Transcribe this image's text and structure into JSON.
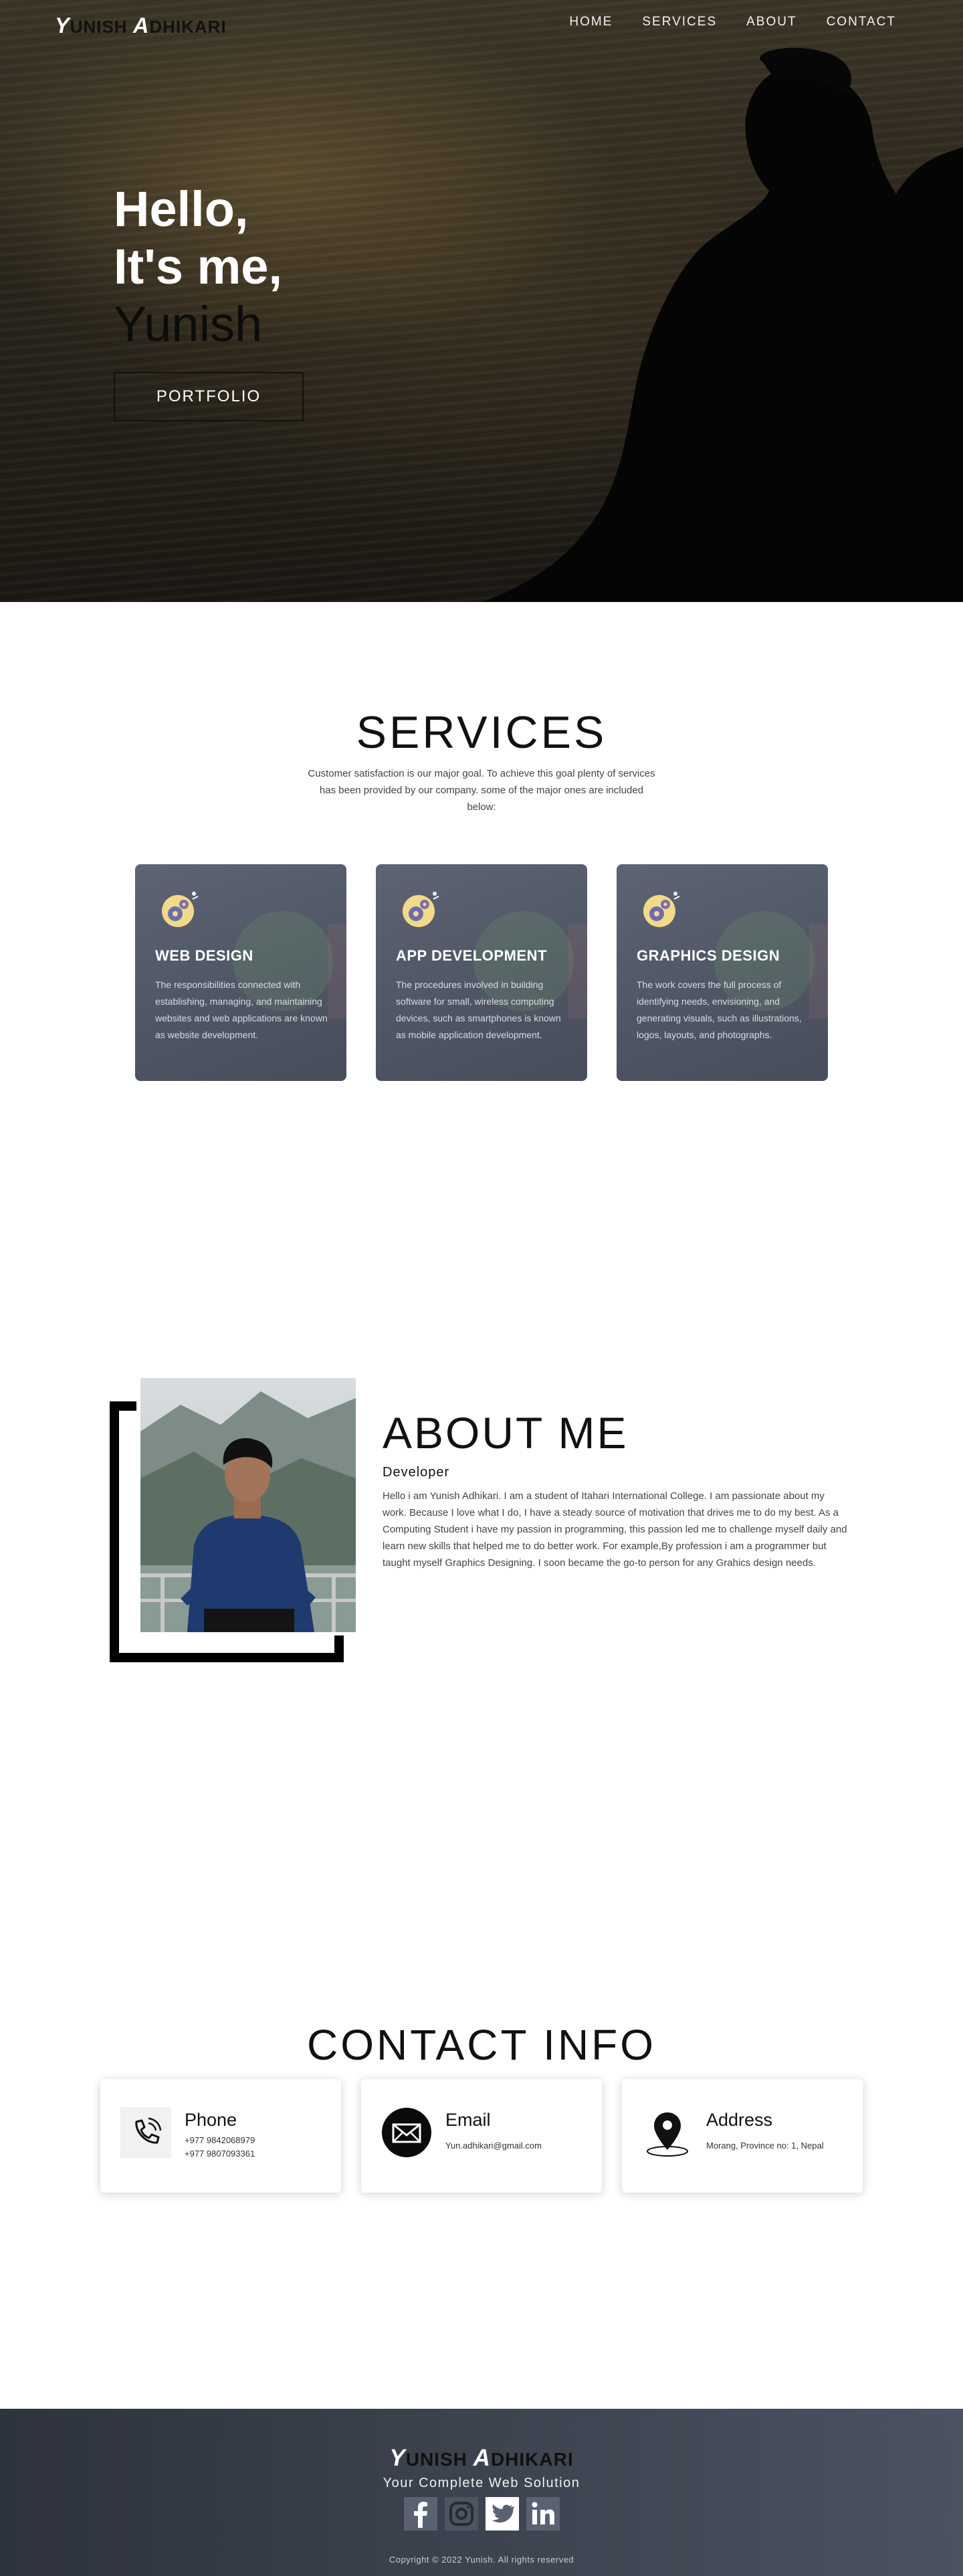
{
  "nav": {
    "logo_initial_1": "Y",
    "logo_rest_1": "UNISH",
    "logo_initial_2": "A",
    "logo_rest_2": "DHIKARI",
    "links": [
      "HOME",
      "SERVICES",
      "ABOUT",
      "CONTACT"
    ]
  },
  "hero": {
    "line1": "Hello,",
    "line2": "It's me,",
    "name": "Yunish",
    "button": "PORTFOLIO"
  },
  "services": {
    "title": "SERVICES",
    "description": "Customer satisfaction is our major goal. To achieve this goal plenty of services has been provided by our company. some of the major ones are included below:",
    "cards": [
      {
        "title": "WEB DESIGN",
        "text": "The responsibilities connected with establishing, managing, and maintaining websites and web applications are known as website development.",
        "icon": "gears-bulb-icon"
      },
      {
        "title": "APP DEVELOPMENT",
        "text": "The procedures involved in building software for small, wireless computing devices, such as smartphones is known as mobile application development.",
        "icon": "gears-bulb-icon"
      },
      {
        "title": "GRAPHICS DESIGN",
        "text": "The work covers the full process of identifying needs, envisioning, and generating visuals, such as illustrations, logos, layouts, and photographs.",
        "icon": "gears-bulb-icon"
      }
    ]
  },
  "about": {
    "title": "ABOUT ME",
    "subtitle": "Developer",
    "text": "Hello i am Yunish Adhikari. I am a student of Itahari International College. I am passionate about my work. Because I love what I do, I have a steady source of motivation that drives me to do my best. As a Computing Student i have my passion in programming, this passion led me to challenge myself daily and learn new skills that helped me to do better work. For example,By profession i am a programmer but taught myself Graphics Designing. I soon became the go-to person for any Grahics design needs."
  },
  "contact": {
    "title": "CONTACT INFO",
    "phone": {
      "label": "Phone",
      "line1": "+977 9842068979",
      "line2": "+977 9807093361",
      "icon": "phone-icon"
    },
    "email": {
      "label": "Email",
      "line1": "Yun.adhikari@gmail.com",
      "icon": "envelope-icon"
    },
    "address": {
      "label": "Address",
      "line1": "Morang, Province no: 1, Nepal",
      "icon": "location-pin-icon"
    }
  },
  "footer": {
    "logo_initial_1": "Y",
    "logo_rest_1": "UNISH",
    "logo_initial_2": "A",
    "logo_rest_2": "DHIKARI",
    "tagline": "Your Complete Web Solution",
    "socials": [
      "facebook-icon",
      "instagram-icon",
      "twitter-icon",
      "linkedin-icon"
    ],
    "copyright": "Copyright © 2022 Yunish. All rights reserved"
  },
  "colors": {
    "footer_bg": "#3e4551",
    "card_bg": "#555c6b",
    "accent_bulb": "#f3d98a"
  }
}
